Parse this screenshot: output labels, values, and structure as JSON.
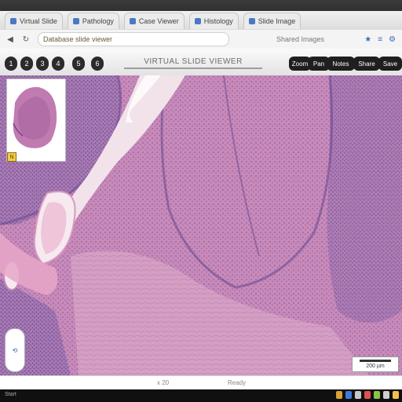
{
  "browser": {
    "tabs": [
      {
        "label": "Virtual Slide"
      },
      {
        "label": "Pathology"
      },
      {
        "label": "Case Viewer"
      },
      {
        "label": "Histology"
      },
      {
        "label": "Slide Image"
      }
    ],
    "url": "Database slide viewer",
    "address_extra": "Shared Images"
  },
  "viewer": {
    "title": "VIRTUAL SLIDE VIEWER",
    "left_tools": [
      "1",
      "2",
      "3",
      "4",
      "5",
      "6"
    ],
    "right_tools": [
      "Zoom",
      "Pan",
      "Notes",
      "Share",
      "Save"
    ],
    "overview_marker": "N"
  },
  "scalebar": {
    "label": "200 µm"
  },
  "status": {
    "left": "x 20",
    "right": "Ready"
  },
  "taskbar": {
    "label": "Start"
  },
  "colors": {
    "tissue_pink": "#c98ab9",
    "tissue_purple": "#7d5aa0",
    "stroma_light": "#f2e2ea"
  }
}
